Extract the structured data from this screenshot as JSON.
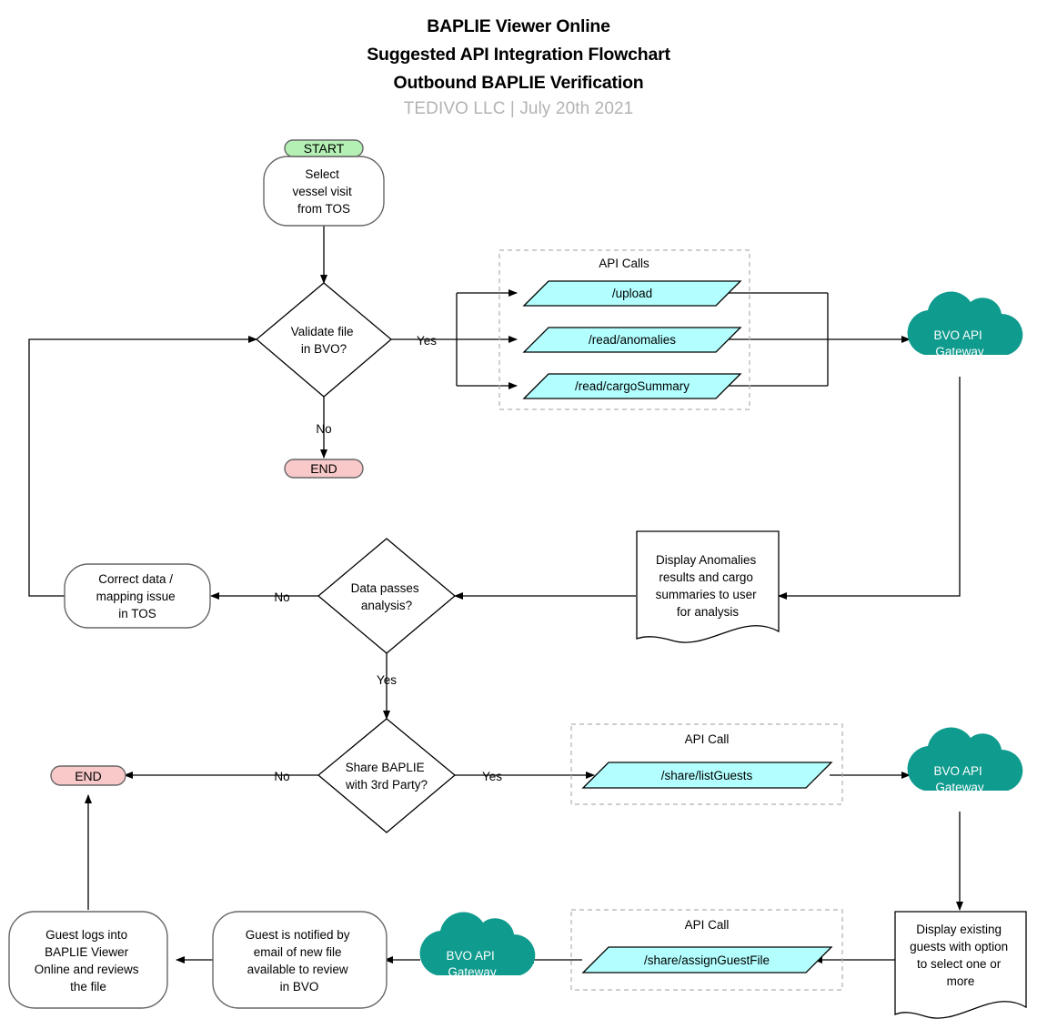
{
  "header": {
    "line1": "BAPLIE Viewer Online",
    "line2": "Suggested API Integration Flowchart",
    "line3": "Outbound BAPLIE Verification",
    "subtitle": "TEDIVO LLC | July 20th 2021"
  },
  "colors": {
    "api_fill": "#b3ffff",
    "cloud_fill": "#0f9b8e",
    "start_fill": "#b4f0b4",
    "end_fill": "#f9c8c8",
    "group_stroke": "#b0b0b0",
    "edge_stroke": "#000000"
  },
  "nodes": {
    "start_badge": "START",
    "select_vessel": [
      "Select",
      "vessel visit",
      "from TOS"
    ],
    "validate_decision": [
      "Validate file",
      "in BVO?"
    ],
    "end_top": "END",
    "api_group_1_label": "API Calls",
    "api_upload": "/upload",
    "api_read_anomalies": "/read/anomalies",
    "api_read_cargo": "/read/cargoSummary",
    "cloud_1": [
      "BVO API",
      "Gateway"
    ],
    "display_anomalies": [
      "Display Anomalies",
      "results and cargo",
      "summaries to user",
      "for analysis"
    ],
    "data_passes_decision": [
      "Data passes",
      "analysis?"
    ],
    "correct_data": [
      "Correct data /",
      "mapping issue",
      "in TOS"
    ],
    "share_decision": [
      "Share BAPLIE",
      "with 3rd Party?"
    ],
    "end_bottom": "END",
    "api_group_2_label": "API Call",
    "api_list_guests": "/share/listGuests",
    "cloud_2": [
      "BVO API",
      "Gateway"
    ],
    "display_guests": [
      "Display existing",
      "guests with option",
      "to select one or",
      "more"
    ],
    "api_group_3_label": "API Call",
    "api_assign_guest": "/share/assignGuestFile",
    "cloud_3": [
      "BVO API",
      "Gateway"
    ],
    "guest_notified": [
      "Guest is notified by",
      "email of new file",
      "available to review",
      "in BVO"
    ],
    "guest_logs_in": [
      "Guest logs into",
      "BAPLIE Viewer",
      "Online and reviews",
      "the file"
    ]
  },
  "edge_labels": {
    "validate_yes": "Yes",
    "validate_no": "No",
    "analysis_no": "No",
    "analysis_yes": "Yes",
    "share_no": "No",
    "share_yes": "Yes"
  }
}
